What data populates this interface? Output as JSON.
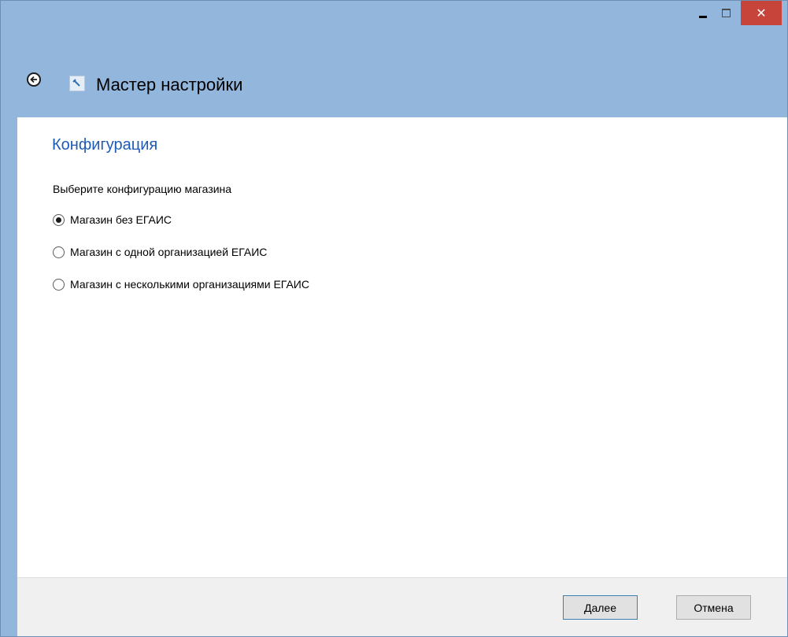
{
  "window": {
    "title": "Мастер настройки",
    "close_glyph": "✕"
  },
  "page": {
    "section_title": "Конфигурация",
    "prompt": "Выберите конфигурацию магазина",
    "options": [
      {
        "label": "Магазин без ЕГАИС",
        "checked": true
      },
      {
        "label": "Магазин с одной организацией ЕГАИС",
        "checked": false
      },
      {
        "label": "Магазин с несколькими организациями ЕГАИС",
        "checked": false
      }
    ]
  },
  "footer": {
    "next_label_accel": "Д",
    "next_label_rest": "алее",
    "cancel_label": "Отмена"
  },
  "icons": {
    "back": "back-arrow-icon",
    "app": "wrench-icon",
    "minimize": "minimize-icon",
    "maximize": "maximize-icon",
    "close": "close-icon"
  },
  "colors": {
    "titlebar": "#93b6dd",
    "close_button": "#c7443b",
    "section_title": "#1e5bb5",
    "footer": "#f0f0f0"
  }
}
